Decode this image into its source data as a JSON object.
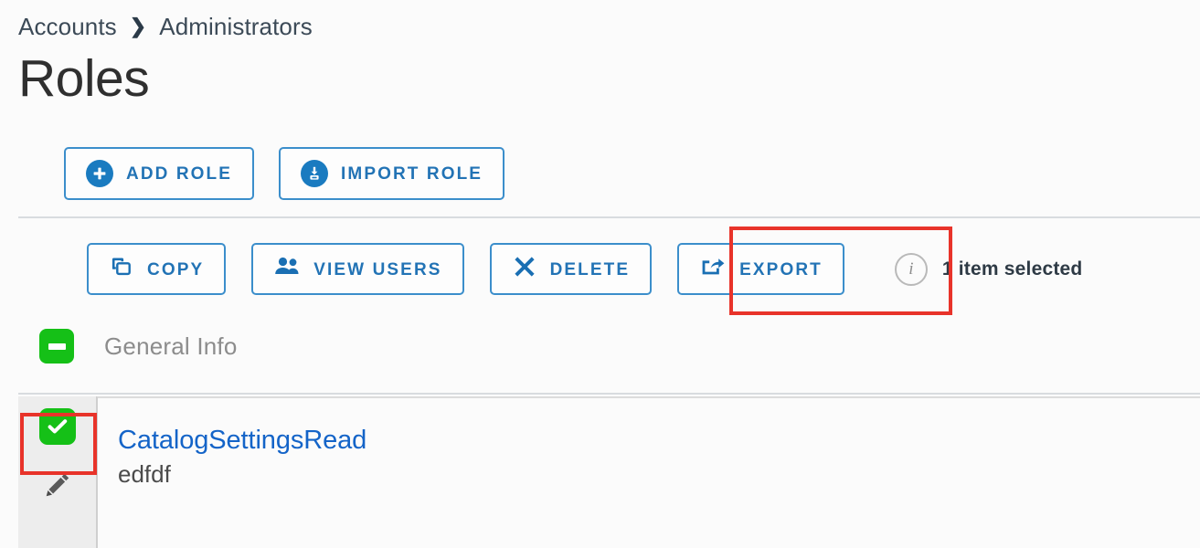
{
  "breadcrumb": {
    "items": [
      "Accounts",
      "Administrators"
    ],
    "separator": "❯"
  },
  "page": {
    "title": "Roles"
  },
  "primary_actions": [
    {
      "label": "ADD ROLE",
      "icon": "plus-circle-icon"
    },
    {
      "label": "IMPORT ROLE",
      "icon": "import-circle-icon"
    }
  ],
  "toolbar": {
    "buttons": [
      {
        "label": "COPY",
        "icon": "copy-icon"
      },
      {
        "label": "VIEW USERS",
        "icon": "users-icon"
      },
      {
        "label": "DELETE",
        "icon": "close-x-icon"
      },
      {
        "label": "EXPORT",
        "icon": "export-icon"
      }
    ],
    "selection_status": "1 item selected",
    "info_icon_glyph": "i"
  },
  "section": {
    "label": "General Info",
    "expanded": true,
    "toggle_icon": "minus-icon"
  },
  "grid": {
    "rows": [
      {
        "selected": true,
        "checkbox_icon": "check-icon",
        "edit_icon": "pencil-icon",
        "title": "CatalogSettingsRead",
        "subtitle": "edfdf"
      }
    ]
  },
  "annotations": [
    {
      "target": "export-button",
      "color": "#e8332a"
    },
    {
      "target": "row-checkbox",
      "color": "#e8332a"
    }
  ],
  "colors": {
    "link_blue": "#1464c8",
    "button_blue": "#2273b5",
    "button_border": "#3b8ecb",
    "icon_blue": "#1a7bc0",
    "green": "#15c017",
    "annotation_red": "#e8332a",
    "page_bg": "#fbfbfb"
  }
}
